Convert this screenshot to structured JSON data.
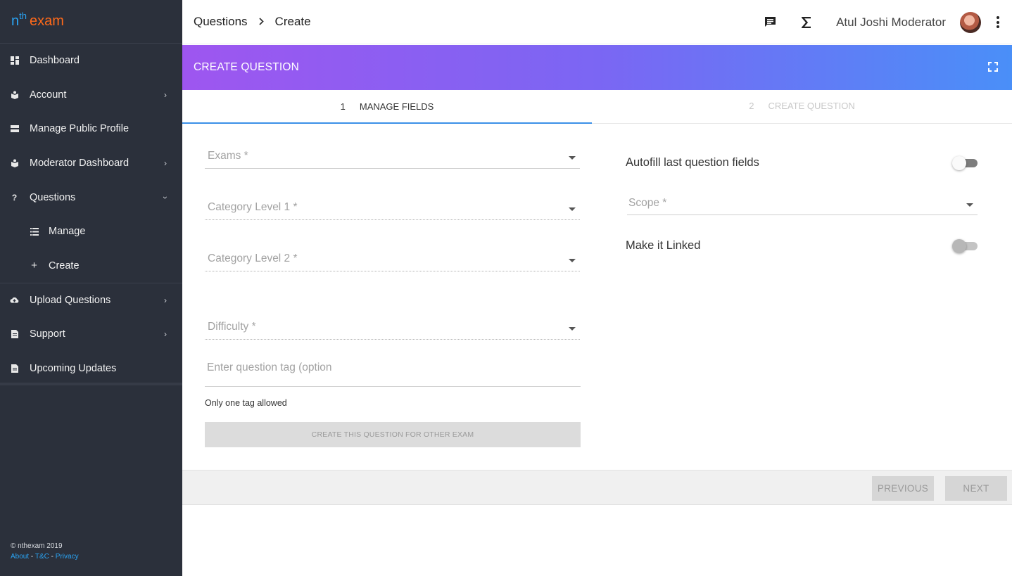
{
  "brand": {
    "n": "n",
    "th": "th",
    "exam": "exam"
  },
  "sidebar": {
    "items": [
      {
        "label": "Dashboard",
        "icon": "dashboard-icon"
      },
      {
        "label": "Account",
        "icon": "account-icon",
        "chevron": "right"
      },
      {
        "label": "Manage Public Profile",
        "icon": "profile-icon"
      },
      {
        "label": "Moderator Dashboard",
        "icon": "moderator-icon",
        "chevron": "right"
      },
      {
        "label": "Questions",
        "icon": "question-icon",
        "chevron": "down"
      },
      {
        "label": "Manage",
        "icon": "list-icon",
        "sub": true
      },
      {
        "label": "Create",
        "icon": "plus-icon",
        "sub": true
      },
      {
        "label": "Upload Questions",
        "icon": "cloud-upload-icon",
        "chevron": "right"
      },
      {
        "label": "Support",
        "icon": "document-icon",
        "chevron": "right"
      },
      {
        "label": "Upcoming Updates",
        "icon": "document-icon"
      }
    ],
    "footer": {
      "copyright": "© nthexam 2019",
      "about": "About",
      "tnc": "T&C",
      "privacy": "Privacy",
      "sep": "-"
    }
  },
  "topbar": {
    "breadcrumb": [
      "Questions",
      "Create"
    ],
    "user_name": "Atul Joshi Moderator",
    "icons": [
      "chat-icon",
      "sigma-icon",
      "avatar",
      "more-vert-icon"
    ]
  },
  "card": {
    "title": "CREATE QUESTION"
  },
  "stepper": {
    "steps": [
      {
        "num": "1",
        "label": "MANAGE FIELDS",
        "active": true
      },
      {
        "num": "2",
        "label": "CREATE QUESTION",
        "active": false
      }
    ]
  },
  "form": {
    "exams_label": "Exams *",
    "category1_label": "Category Level 1 *",
    "category2_label": "Category Level 2 *",
    "difficulty_label": "Difficulty *",
    "tag_placeholder": "Enter question tag (option",
    "tag_hint": "Only one tag allowed",
    "other_exam_button": "CREATE THIS QUESTION FOR OTHER EXAM",
    "autofill_label": "Autofill last question fields",
    "scope_label": "Scope *",
    "linked_label": "Make it Linked"
  },
  "actions": {
    "previous": "PREVIOUS",
    "next": "NEXT"
  },
  "colors": {
    "sidebar_bg": "#2b303b",
    "brand_blue": "#2aa4f4",
    "brand_orange": "#ff6a1a",
    "gradient_start": "#9e56f0",
    "gradient_end": "#4a8ff8",
    "active_step": "#3b90e8"
  }
}
